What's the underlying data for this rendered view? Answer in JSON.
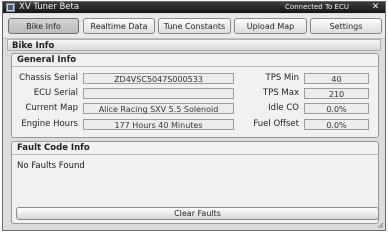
{
  "window": {
    "title": "XV Tuner Beta",
    "status": "Connected To ECU",
    "close_glyph": "✕"
  },
  "tabs": [
    {
      "label": "Bike Info",
      "active": true
    },
    {
      "label": "Realtime Data",
      "active": false
    },
    {
      "label": "Tune Constants",
      "active": false
    },
    {
      "label": "Upload Map",
      "active": false
    },
    {
      "label": "Settings",
      "active": false
    }
  ],
  "section": {
    "title": "Bike Info"
  },
  "general": {
    "title": "General Info",
    "fields": {
      "chassis_serial": {
        "label": "Chassis Serial",
        "value": "ZD4VSC5047S000533"
      },
      "ecu_serial": {
        "label": "ECU Serial",
        "value": ""
      },
      "current_map": {
        "label": "Current Map",
        "value": "Alice Racing SXV 5.5 Solenoid"
      },
      "engine_hours": {
        "label": "Engine Hours",
        "value": "177 Hours 40 Minutes"
      }
    },
    "metrics": {
      "tps_min": {
        "label": "TPS Min",
        "value": "40"
      },
      "tps_max": {
        "label": "TPS Max",
        "value": "210"
      },
      "idle_co": {
        "label": "Idle CO",
        "value": "0.0%"
      },
      "fuel_offset": {
        "label": "Fuel Offset",
        "value": "0.0%"
      }
    }
  },
  "faults": {
    "title": "Fault Code Info",
    "message": "No Faults Found",
    "clear_label": "Clear Faults"
  },
  "icons": {
    "app": "app-logo-icon",
    "close": "close-icon",
    "resize": "resize-grip-icon"
  }
}
